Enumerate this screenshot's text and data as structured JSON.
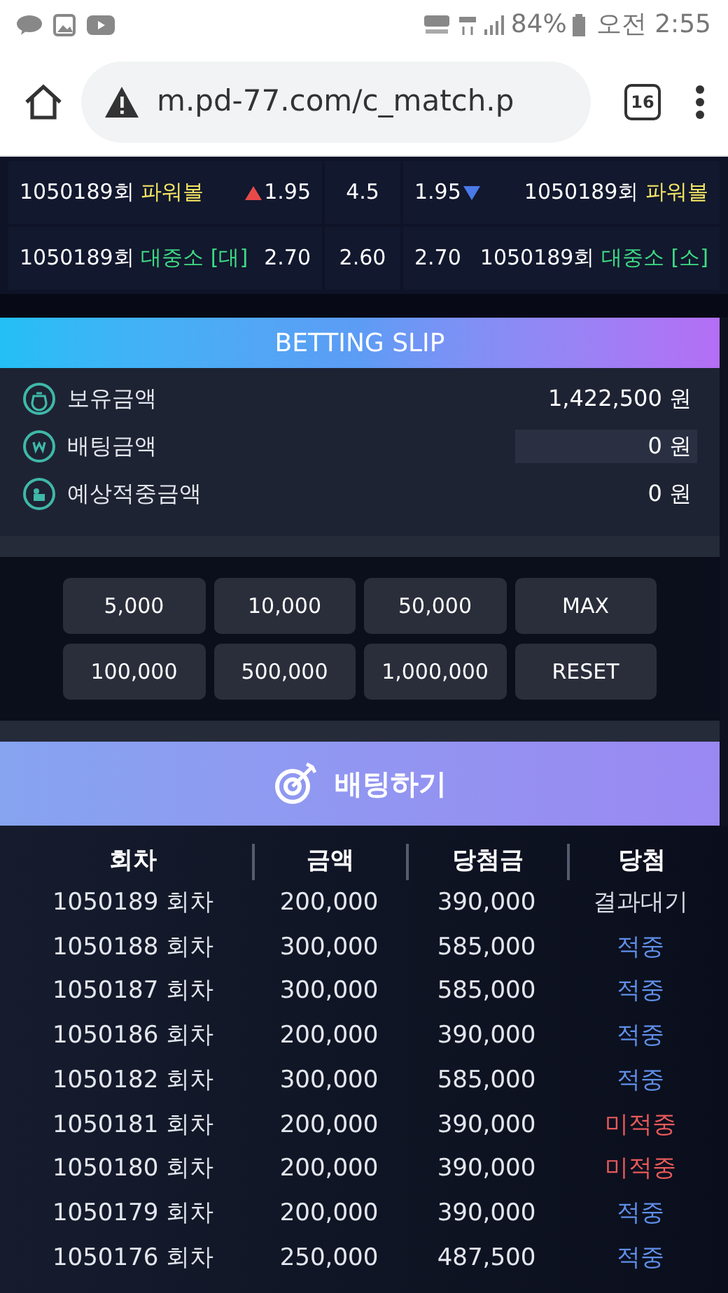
{
  "status_bar": {
    "battery": "84%",
    "time": "오전 2:55"
  },
  "browser": {
    "url": "m.pd-77.com/c_match.p",
    "tab_count": "16"
  },
  "odds_rows": [
    {
      "left": {
        "round": "1050189회",
        "game": "파워볼",
        "color": "#f5e663",
        "odds": "1.95",
        "rising": true
      },
      "line": "4.5",
      "right": {
        "round": "1050189회",
        "game": "파워볼",
        "color": "#f5e663",
        "odds": "1.95",
        "falling": true
      }
    },
    {
      "left": {
        "round": "1050189회",
        "game": "대중소 [대]",
        "color": "#3ddc84",
        "odds": "2.70",
        "rising": false
      },
      "line": "2.60",
      "right": {
        "round": "1050189회",
        "game": "대중소 [소]",
        "color": "#3ddc84",
        "odds": "2.70",
        "falling": false
      }
    }
  ],
  "slip": {
    "title": "BETTING SLIP",
    "rows": [
      {
        "kind": "balance",
        "label": "보유금액",
        "value": "1,422,500 원"
      },
      {
        "kind": "bet",
        "label": "배팅금액",
        "value": "0 원"
      },
      {
        "kind": "expected",
        "label": "예상적중금액",
        "value": "0 원"
      }
    ],
    "chips": [
      "5,000",
      "10,000",
      "50,000",
      "MAX",
      "100,000",
      "500,000",
      "1,000,000",
      "RESET"
    ],
    "bet_button": "배팅하기"
  },
  "history": {
    "columns": [
      "회차",
      "금액",
      "당첨금",
      "당첨"
    ],
    "rows": [
      {
        "round": "1050189 회차",
        "amount": "200,000",
        "payout": "390,000",
        "result": "결과대기",
        "kind": "pending"
      },
      {
        "round": "1050188 회차",
        "amount": "300,000",
        "payout": "585,000",
        "result": "적중",
        "kind": "hit"
      },
      {
        "round": "1050187 회차",
        "amount": "300,000",
        "payout": "585,000",
        "result": "적중",
        "kind": "hit"
      },
      {
        "round": "1050186 회차",
        "amount": "200,000",
        "payout": "390,000",
        "result": "적중",
        "kind": "hit"
      },
      {
        "round": "1050182 회차",
        "amount": "300,000",
        "payout": "585,000",
        "result": "적중",
        "kind": "hit"
      },
      {
        "round": "1050181 회차",
        "amount": "200,000",
        "payout": "390,000",
        "result": "미적중",
        "kind": "miss"
      },
      {
        "round": "1050180 회차",
        "amount": "200,000",
        "payout": "390,000",
        "result": "미적중",
        "kind": "miss"
      },
      {
        "round": "1050179 회차",
        "amount": "200,000",
        "payout": "390,000",
        "result": "적중",
        "kind": "hit"
      },
      {
        "round": "1050176 회차",
        "amount": "250,000",
        "payout": "487,500",
        "result": "적중",
        "kind": "hit"
      }
    ]
  }
}
